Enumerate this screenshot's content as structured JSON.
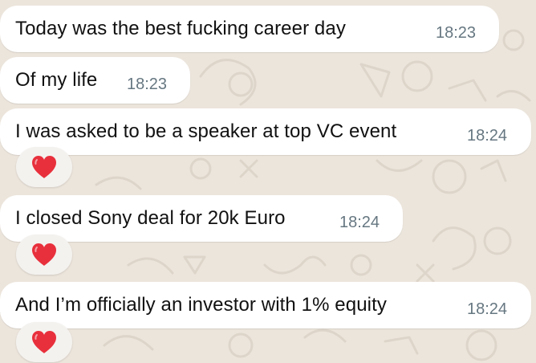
{
  "messages": [
    {
      "text": "Today was the best fucking career day",
      "time": "18:23",
      "reaction": ""
    },
    {
      "text": "Of my life",
      "time": "18:23",
      "reaction": ""
    },
    {
      "text": "I was asked to be a speaker at top VC event",
      "time": "18:24",
      "reaction": "red-heart"
    },
    {
      "text": "I closed Sony deal for 20k Euro",
      "time": "18:24",
      "reaction": "red-heart"
    },
    {
      "text": "And I’m officially an investor with 1% equity",
      "time": "18:24",
      "reaction": "red-heart"
    }
  ],
  "colors": {
    "background": "#ece5dc",
    "bubble": "#ffffff",
    "timestamp": "#667781",
    "reaction_pill": "#f4f2ef",
    "heart": "#e8303c"
  }
}
